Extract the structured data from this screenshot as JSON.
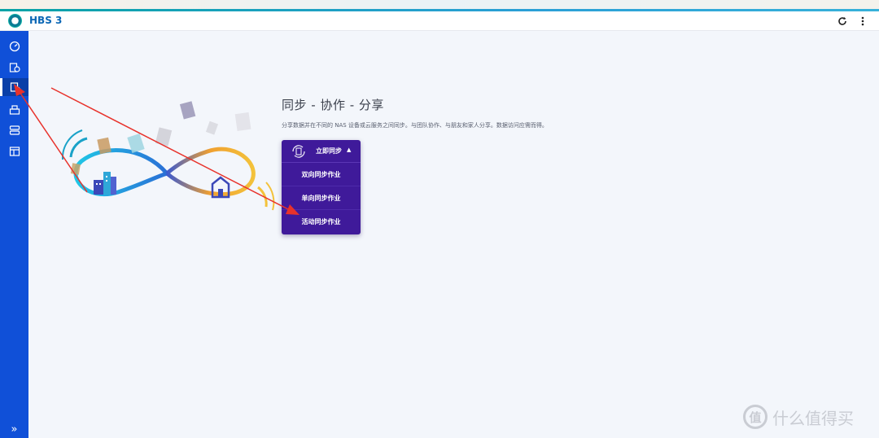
{
  "app": {
    "title": "HBS 3"
  },
  "titlebar": {
    "refresh_icon": "refresh-icon",
    "more_icon": "more-vertical-icon"
  },
  "sidebar": {
    "items": [
      {
        "icon": "dashboard-icon",
        "active": false
      },
      {
        "icon": "backup-restore-icon",
        "active": false
      },
      {
        "icon": "sync-icon",
        "active": true
      },
      {
        "icon": "services-icon",
        "active": false
      },
      {
        "icon": "storage-icon",
        "active": false
      },
      {
        "icon": "logs-icon",
        "active": false
      }
    ],
    "expand_label": "»"
  },
  "hero": {
    "title": "同步 - 协作 - 分享",
    "description": "分享数据并在不同的 NAS 设备或云服务之间同步。与团队协作、与朋友和家人分享。数据访问应需而得。"
  },
  "sync_menu": {
    "label": "立即同步",
    "caret": "▲",
    "options": [
      "双向同步作业",
      "单向同步作业",
      "活动同步作业"
    ]
  },
  "watermark": {
    "logo": "值",
    "text": "什么值得买"
  },
  "colors": {
    "sidebar": "#1050d8",
    "accent": "#0b67b5",
    "menu": "#3f1a9a",
    "annotation": "#e8322b"
  }
}
